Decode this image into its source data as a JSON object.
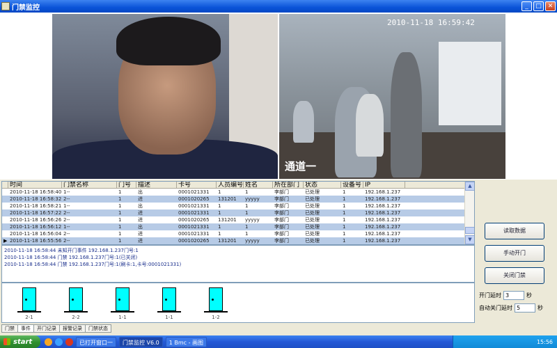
{
  "window": {
    "title": "门禁监控"
  },
  "cameras": [
    {
      "timestamp": "",
      "name": ""
    },
    {
      "timestamp": "2010-11-18 16:59:42",
      "name": "通道一"
    }
  ],
  "log_table": {
    "columns": [
      "时间",
      "门禁名称",
      "门号",
      "描述",
      "卡号",
      "人员编号",
      "姓名",
      "所在部门",
      "状态",
      "设备号",
      "IP"
    ],
    "rows": [
      [
        "2010-11-18 16:58:40",
        "1--",
        "1",
        "出",
        "0001021331",
        "1",
        "1",
        "李部门",
        "已处理",
        "1",
        "192.168.1.237"
      ],
      [
        "2010-11-18 16:58:32",
        "2--",
        "1",
        "进",
        "0001020265",
        "131201",
        "yyyyy",
        "李部门",
        "已处理",
        "1",
        "192.168.1.237"
      ],
      [
        "2010-11-18 16:58:21",
        "1--",
        "1",
        "出",
        "0001021331",
        "1",
        "1",
        "李部门",
        "已处理",
        "1",
        "192.168.1.237"
      ],
      [
        "2010-11-18 16:57:22",
        "2--",
        "1",
        "进",
        "0001021331",
        "1",
        "1",
        "李部门",
        "已处理",
        "1",
        "192.168.1.237"
      ],
      [
        "2010-11-18 16:56:26",
        "2--",
        "1",
        "进",
        "0001020265",
        "131201",
        "yyyyy",
        "李部门",
        "已处理",
        "1",
        "192.168.1.237"
      ],
      [
        "2010-11-18 16:56:12",
        "1--",
        "1",
        "出",
        "0001021331",
        "1",
        "1",
        "李部门",
        "已处理",
        "1",
        "192.168.1.237"
      ],
      [
        "2010-11-18 16:56:04",
        "2--",
        "1",
        "进",
        "0001021331",
        "1",
        "1",
        "李部门",
        "已处理",
        "1",
        "192.168.1.237"
      ],
      [
        "2010-11-18 16:55:56",
        "2--",
        "1",
        "进",
        "0001020265",
        "131201",
        "yyyyy",
        "李部门",
        "已处理",
        "1",
        "192.168.1.237"
      ]
    ]
  },
  "messages": [
    "2010-11-18 16:58:44 未知开门事件 192.168.1.237门号:1",
    "2010-11-18 16:58:44 门禁 192.168.1.237门号:1(已关闭)",
    "2010-11-18 16:58:44 门禁 192.168.1.237门号:1(刷卡:1,卡号:0001021331)"
  ],
  "doors": [
    "2-1",
    "2-2",
    "1-1",
    "1-1",
    "1-2"
  ],
  "buttons": {
    "btn1": "读取数据",
    "btn2": "手动开门",
    "btn3": "关闭门禁"
  },
  "fields": {
    "open_delay_label": "开门延时",
    "open_delay_value": "3",
    "open_delay_unit": "秒",
    "auto_close_label": "自动关门延时",
    "auto_close_value": "5",
    "auto_close_unit": "秒"
  },
  "tabs": [
    "门禁",
    "事件",
    "开门记录",
    "报警记录",
    "门禁状态"
  ],
  "taskbar": {
    "start": "start",
    "tasks": [
      "已打开窗口一",
      "门禁监控 V6.0",
      "1 Bmc - 画图"
    ],
    "clock": "15:56"
  }
}
